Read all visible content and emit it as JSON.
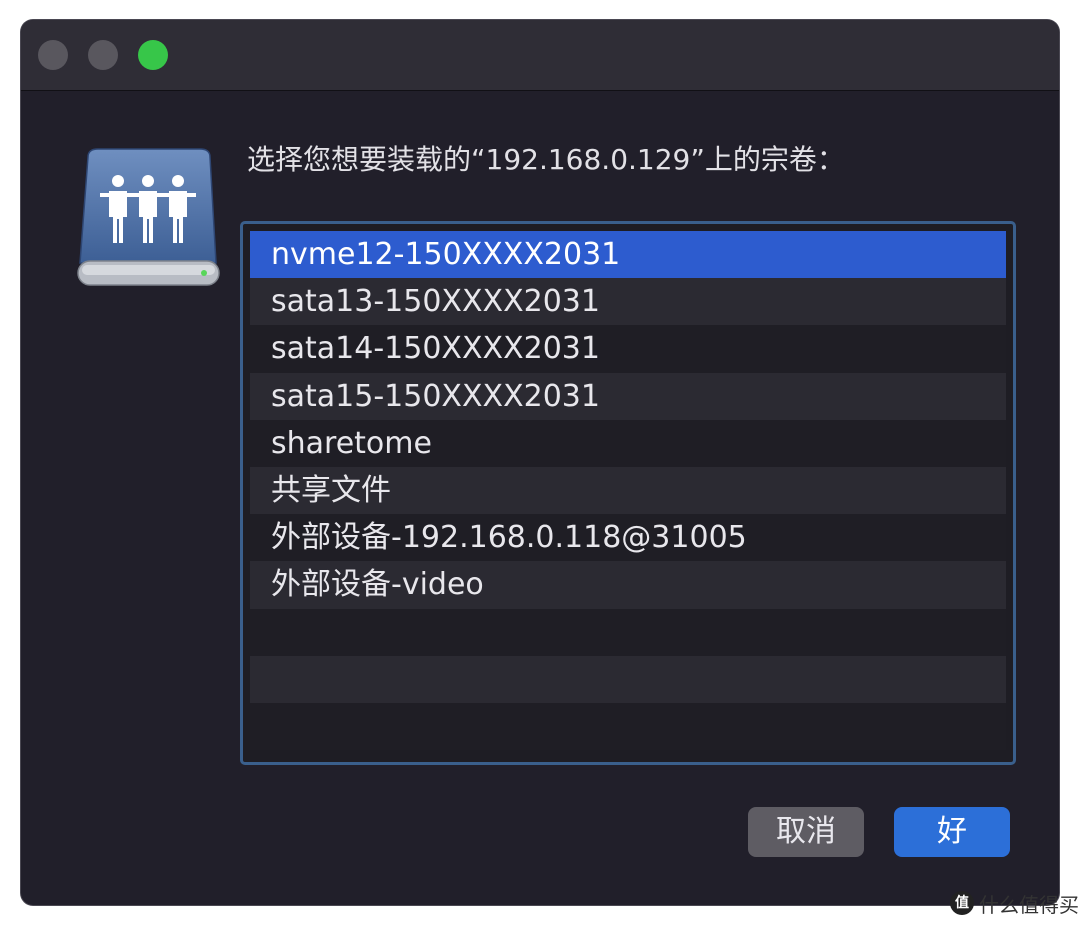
{
  "window": {
    "traffic_lights": [
      "close",
      "minimize",
      "zoom"
    ]
  },
  "dialog": {
    "icon": "network-drive-icon",
    "prompt": "选择您想要装载的“192.168.0.129”上的宗卷："
  },
  "volumes": {
    "selected_index": 0,
    "items": [
      "nvme12-150XXXX2031",
      "sata13-150XXXX2031",
      "sata14-150XXXX2031",
      "sata15-150XXXX2031",
      "sharetome",
      "共享文件",
      "外部设备-192.168.0.118@31005",
      "外部设备-video"
    ]
  },
  "buttons": {
    "cancel": "取消",
    "ok": "好"
  },
  "watermark": {
    "logo": "值",
    "text": "什么值得买"
  },
  "colors": {
    "window_bg": "#211f2a",
    "selection": "#2d5ccf",
    "ok_button": "#2c6fd8",
    "zoom_light": "#37c649"
  }
}
